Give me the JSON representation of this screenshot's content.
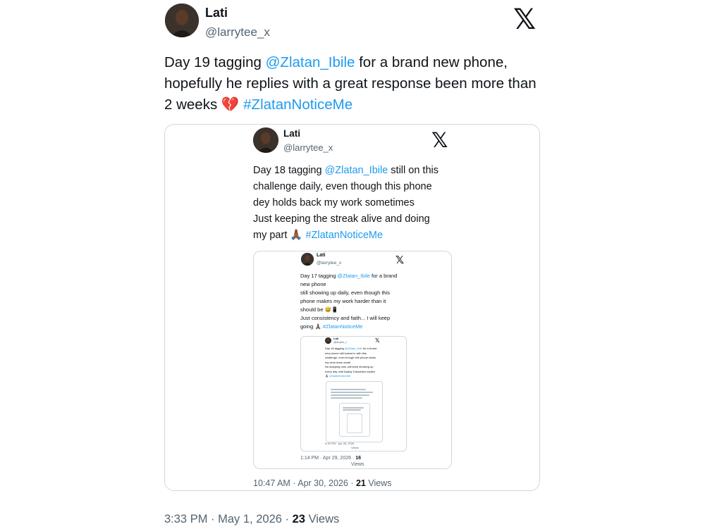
{
  "post": {
    "name": "Lati",
    "handle": "@larrytee_x",
    "text_1": "Day 19 tagging ",
    "mention": "@Zlatan_Ibile",
    "text_2": " for a brand new phone,",
    "line_2": "hopefully he replies with a great response been more than",
    "line_3_start": "2 weeks ",
    "emoji": "💔",
    "hashtag": "#ZlatanNoticeMe",
    "time": "3:33 PM",
    "date": "May 1, 2026",
    "views_count": "23",
    "views_label": "Views"
  },
  "quote1": {
    "name": "Lati",
    "handle": "@larrytee_x",
    "line_1a": "Day 18 tagging ",
    "mention": "@Zlatan_Ibile",
    "line_1b": " still on this",
    "line_2": "challenge daily, even though this phone",
    "line_3": "dey holds back my work sometimes",
    "line_4": "Just keeping the streak alive and doing",
    "line_5": "my part ",
    "emoji": "🙏🏾",
    "hashtag": "#ZlatanNoticeMe",
    "time": "10:47 AM",
    "date": "Apr 30, 2026",
    "views_count": "21",
    "views_label": "Views"
  },
  "quote2": {
    "name": "Lati",
    "handle": "@larrytee_x",
    "line_1a": "Day 17 tagging ",
    "mention": "@Zlatan_Ibile",
    "line_1b": " for a brand",
    "line_2": "new phone",
    "line_3": "still showing up daily, even though this",
    "line_4": "phone makes my work harder than it",
    "line_5": "should be ",
    "emoji_5": "😅📱",
    "line_6": "Just consistency and faith... I will keep",
    "line_7": "going ",
    "emoji_7": "🙏🏾",
    "hashtag": "#ZlatanNoticeMe",
    "time": "1:14 PM",
    "date": "Apr 29, 2026",
    "views_count": "16",
    "views_label": "Views"
  },
  "quote3": {
    "name": "Lati",
    "handle": "@larrytee_x",
    "line_1a": "Day 16 tagging ",
    "mention": "@Zlatan_Ibile",
    "line_1b": " for a brand",
    "line_2": "new phone still locked in with this",
    "line_3": "challenge, even though this phone slows",
    "line_4": "my work down small",
    "line_5": "No stopping now, will keep showing up",
    "line_6": "every day until Daddy Tobunbian replies",
    "hashtag": "🙏🏾 #ZlatanNoticeMe",
    "time": "5:39 PM",
    "date": "Apr 28, 2026",
    "views_label": "Views"
  },
  "icons": {
    "x_logo": "x-logo-icon"
  },
  "colors": {
    "link": "#1d9bf0",
    "text": "#0f1419",
    "muted": "#536471",
    "border": "#cfd9de"
  }
}
